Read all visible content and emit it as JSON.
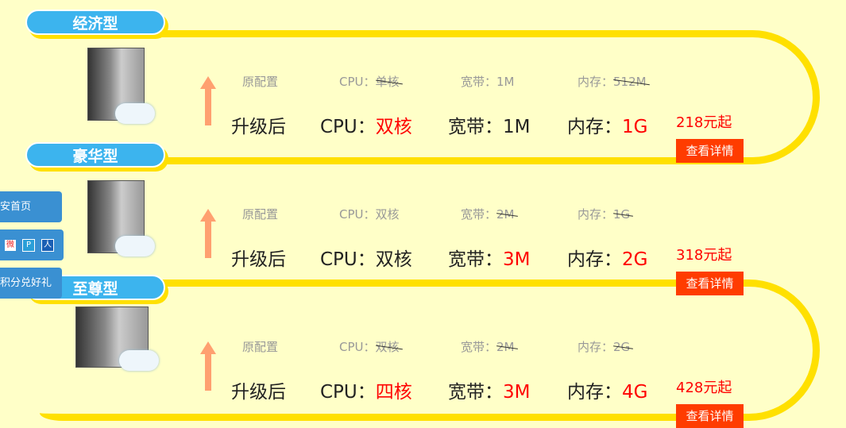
{
  "plans": [
    {
      "name": "经济型",
      "orig_label": "原配置",
      "orig_cpu_label": "CPU：",
      "orig_cpu": "单核",
      "orig_cpu_struck": true,
      "orig_bw_label": "宽带：",
      "orig_bw": "1M",
      "orig_bw_struck": false,
      "orig_mem_label": "内存：",
      "orig_mem": "512M",
      "orig_mem_struck": true,
      "new_label": "升级后",
      "cpu_label": "CPU：",
      "cpu": "双核",
      "cpu_red": true,
      "bw_label": "宽带：",
      "bw": "1M",
      "bw_red": false,
      "mem_label": "内存：",
      "mem": "1G",
      "mem_red": true,
      "price": "218元起",
      "details": "查看详情"
    },
    {
      "name": "豪华型",
      "orig_label": "原配置",
      "orig_cpu_label": "CPU：",
      "orig_cpu": "双核",
      "orig_cpu_struck": false,
      "orig_bw_label": "宽带：",
      "orig_bw": "2M",
      "orig_bw_struck": true,
      "orig_mem_label": "内存：",
      "orig_mem": "1G",
      "orig_mem_struck": true,
      "new_label": "升级后",
      "cpu_label": "CPU：",
      "cpu": "双核",
      "cpu_red": false,
      "bw_label": "宽带：",
      "bw": "3M",
      "bw_red": true,
      "mem_label": "内存：",
      "mem": "2G",
      "mem_red": true,
      "price": "318元起",
      "details": "查看详情"
    },
    {
      "name": "至尊型",
      "orig_label": "原配置",
      "orig_cpu_label": "CPU：",
      "orig_cpu": "双核",
      "orig_cpu_struck": true,
      "orig_bw_label": "宽带：",
      "orig_bw": "2M",
      "orig_bw_struck": true,
      "orig_mem_label": "内存：",
      "orig_mem": "2G",
      "orig_mem_struck": true,
      "new_label": "升级后",
      "cpu_label": "CPU：",
      "cpu": "四核",
      "cpu_red": true,
      "bw_label": "宽带：",
      "bw": "3M",
      "bw_red": true,
      "mem_label": "内存：",
      "mem": "4G",
      "mem_red": true,
      "price": "428元起",
      "details": "查看详情"
    }
  ],
  "sidebar": {
    "home": "安首页",
    "share_icons": [
      "weibo-icon",
      "tencent-icon",
      "renren-icon"
    ],
    "points": "积分兑好礼"
  },
  "colors": {
    "accent": "#3cb4ee",
    "track": "#ffe000",
    "button": "#ff3c00",
    "price": "#ff0000"
  }
}
